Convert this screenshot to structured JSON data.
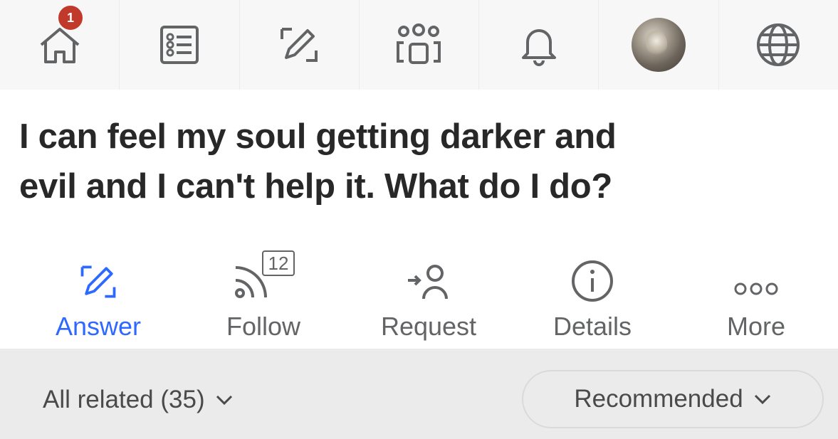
{
  "nav": {
    "home_badge": "1",
    "items": [
      {
        "name": "home",
        "icon": "house-icon"
      },
      {
        "name": "following",
        "icon": "list-icon"
      },
      {
        "name": "answer",
        "icon": "pencil-square-icon"
      },
      {
        "name": "spaces",
        "icon": "people-icon"
      },
      {
        "name": "notifications",
        "icon": "bell-icon"
      },
      {
        "name": "profile",
        "icon": "avatar"
      },
      {
        "name": "language",
        "icon": "globe-icon"
      }
    ]
  },
  "question": {
    "line1": "I can feel my soul getting darker and",
    "line2": "evil and I can't help it. What do I do?"
  },
  "actions": {
    "answer_label": "Answer",
    "follow_label": "Follow",
    "follow_count": "12",
    "request_label": "Request",
    "details_label": "Details",
    "more_label": "More"
  },
  "filter": {
    "related_label": "All related (35)",
    "sort_label": "Recommended"
  },
  "colors": {
    "accent": "#2e69ff",
    "text": "#282829",
    "muted": "#636466",
    "badge": "#c0392b"
  }
}
